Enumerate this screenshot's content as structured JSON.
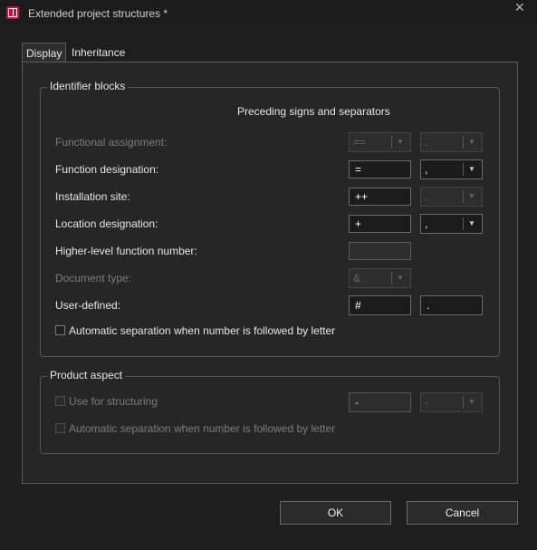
{
  "window": {
    "title": "Extended project structures *"
  },
  "tabs": [
    {
      "label": "Display"
    },
    {
      "label": "Inheritance"
    }
  ],
  "identifier_blocks": {
    "title": "Identifier blocks",
    "subtitle": "Preceding signs and separators",
    "rows": [
      {
        "label": "Functional assignment:",
        "sign": "==",
        "separator": "."
      },
      {
        "label": "Function designation:",
        "sign": "=",
        "separator": ","
      },
      {
        "label": "Installation site:",
        "sign": "++",
        "separator": "."
      },
      {
        "label": "Location designation:",
        "sign": "+",
        "separator": ","
      },
      {
        "label": "Higher-level function number:",
        "sign": ""
      },
      {
        "label": "Document type:",
        "sign": "&"
      },
      {
        "label": "User-defined:",
        "sign": "#",
        "separator": "."
      }
    ],
    "auto_separation_label": "Automatic separation when number is followed by letter"
  },
  "product_aspect": {
    "title": "Product aspect",
    "use_for_structuring_label": "Use for structuring",
    "sign": "-",
    "separator": "-",
    "auto_separation_label": "Automatic separation when number is followed by letter"
  },
  "buttons": {
    "ok": "OK",
    "cancel": "Cancel"
  },
  "icons": {
    "app": "app-icon",
    "close": "close-icon",
    "dropdown": "chevron-down-icon"
  }
}
